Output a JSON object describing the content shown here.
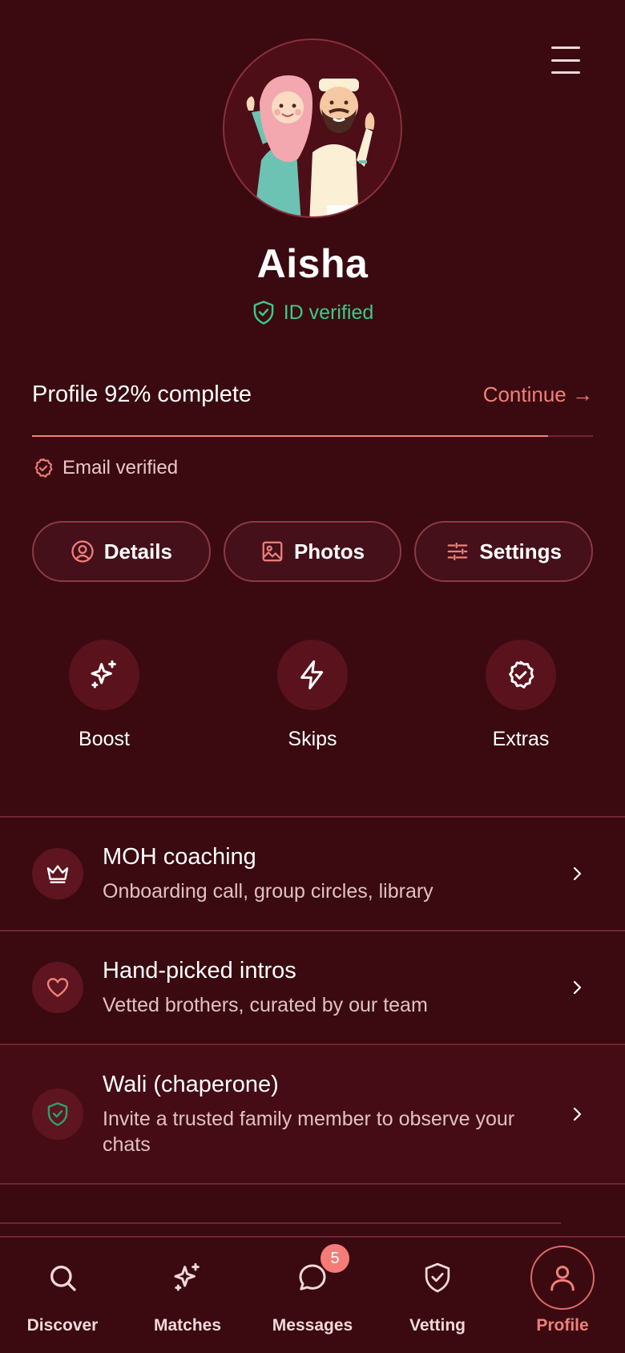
{
  "profile": {
    "name": "Aisha",
    "verification": "ID verified",
    "email_status": "Email verified"
  },
  "progress": {
    "title": "Profile 92% complete",
    "percent": 92,
    "continue_label": "Continue →"
  },
  "pills": [
    {
      "label": "Details",
      "icon": "user-circle-icon"
    },
    {
      "label": "Photos",
      "icon": "image-icon"
    },
    {
      "label": "Settings",
      "icon": "sliders-icon"
    }
  ],
  "quick_actions": [
    {
      "label": "Boost",
      "icon": "sparkles-icon"
    },
    {
      "label": "Skips",
      "icon": "lightning-icon"
    },
    {
      "label": "Extras",
      "icon": "badge-check-icon"
    }
  ],
  "list": [
    {
      "title": "MOH coaching",
      "subtitle": "Onboarding call, group circles, library",
      "icon": "crown-icon"
    },
    {
      "title": "Hand-picked intros",
      "subtitle": "Vetted brothers, curated by our team",
      "icon": "heart-icon"
    },
    {
      "title": "Wali (chaperone)",
      "subtitle": "Invite a trusted family member to observe your chats",
      "icon": "shield-check-icon"
    }
  ],
  "nav": [
    {
      "label": "Discover",
      "icon": "search-icon"
    },
    {
      "label": "Matches",
      "icon": "sparkles-icon"
    },
    {
      "label": "Messages",
      "icon": "chat-icon",
      "badge": "5"
    },
    {
      "label": "Vetting",
      "icon": "shield-check-icon"
    },
    {
      "label": "Profile",
      "icon": "user-icon",
      "active": true
    }
  ],
  "colors": {
    "background": "#3a0a10",
    "accent": "#f0807a",
    "verified": "#3cc98a"
  }
}
